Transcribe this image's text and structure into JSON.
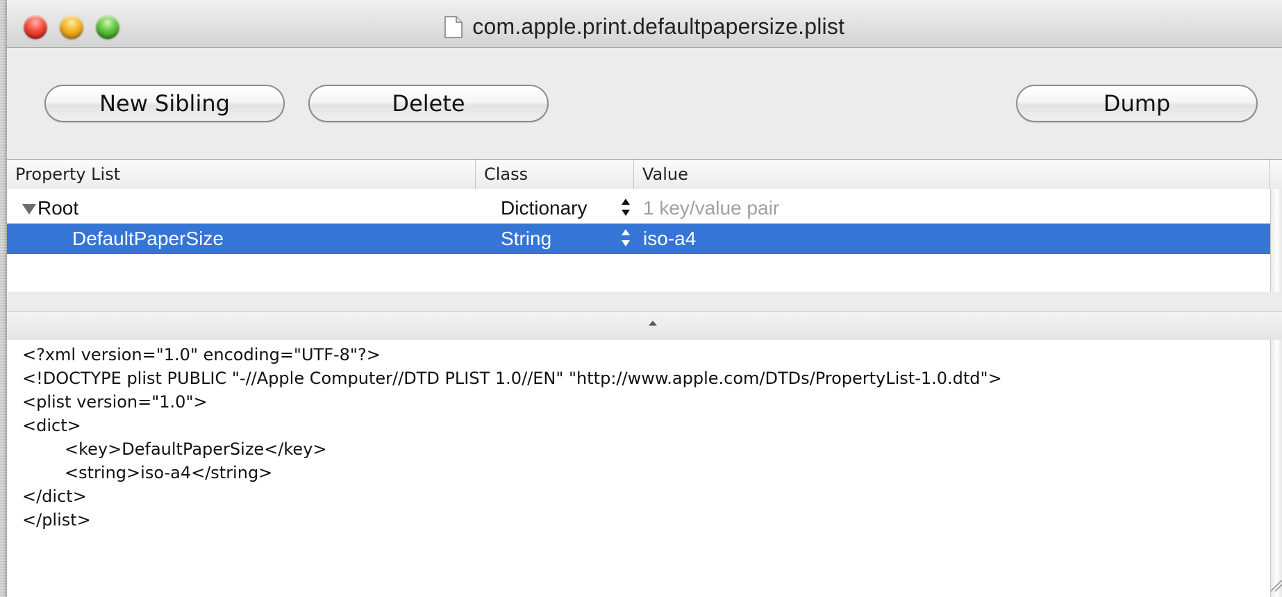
{
  "window": {
    "title": "com.apple.print.defaultpapersize.plist",
    "doc_icon": "document-icon"
  },
  "toolbar": {
    "new_sibling_label": "New Sibling",
    "delete_label": "Delete",
    "dump_label": "Dump"
  },
  "table": {
    "columns": [
      "Property List",
      "Class",
      "Value"
    ],
    "rows": [
      {
        "key": "Root",
        "class": "Dictionary",
        "value": "1 key/value pair",
        "expanded": true,
        "selected": false
      },
      {
        "key": "DefaultPaperSize",
        "class": "String",
        "value": "iso-a4",
        "selected": true
      }
    ]
  },
  "colors": {
    "selection": "#3475d6",
    "placeholder_value": "#a0a0a0"
  },
  "xml": {
    "lines": [
      "<?xml version=\"1.0\" encoding=\"UTF-8\"?>",
      "<!DOCTYPE plist PUBLIC \"-//Apple Computer//DTD PLIST 1.0//EN\" \"http://www.apple.com/DTDs/PropertyList-1.0.dtd\">",
      "<plist version=\"1.0\">",
      "<dict>",
      "        <key>DefaultPaperSize</key>",
      "        <string>iso-a4</string>",
      "</dict>",
      "</plist>"
    ]
  }
}
